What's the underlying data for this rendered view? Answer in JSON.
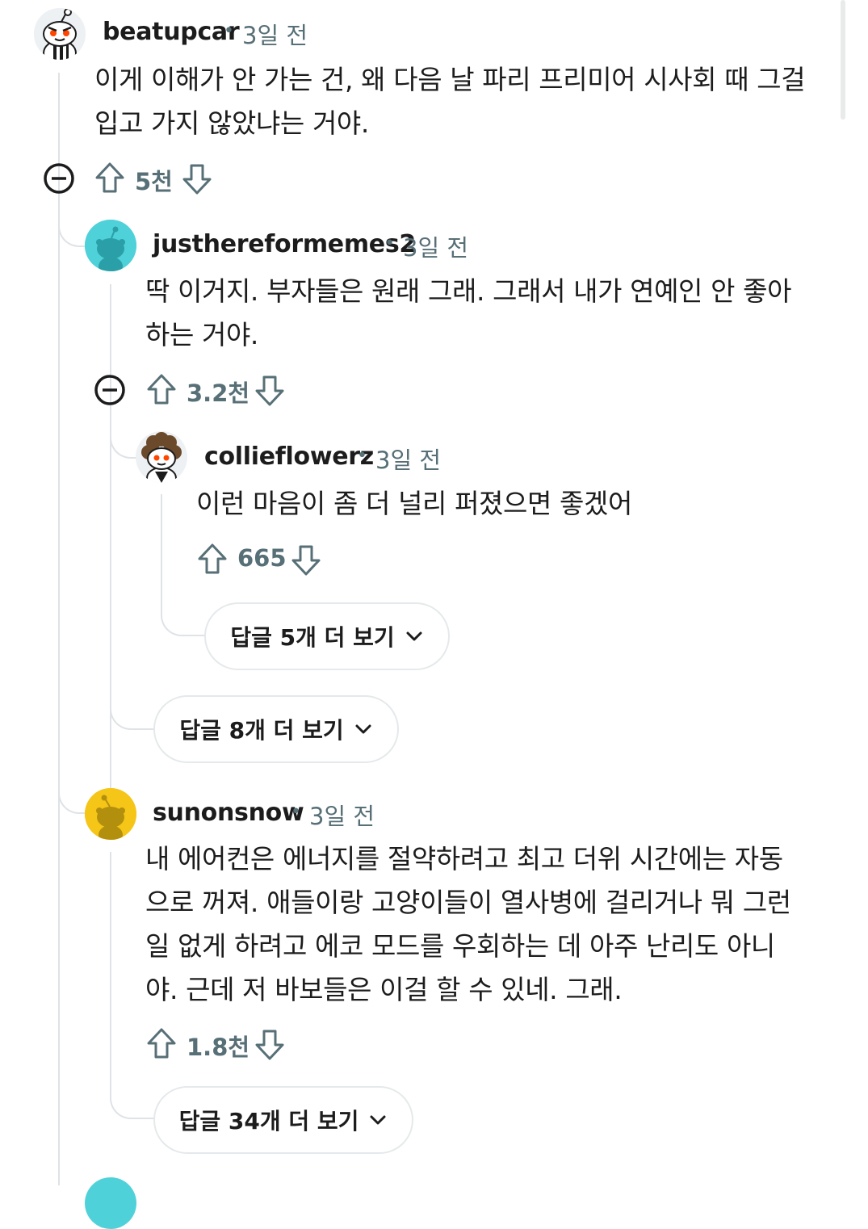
{
  "comments": [
    {
      "username": "beatupcar",
      "time": "3일 전",
      "lines": [
        "이게 이해가 안 가는 건, 왜 다음 날 파리 프리미어 시사회 때 그걸",
        "입고 가지 않았냐는 거야."
      ],
      "score": "5천"
    },
    {
      "username": "justhereformemes2",
      "time": "3일 전",
      "lines": [
        "딱 이거지. 부자들은 원래 그래. 그래서 내가 연예인 안 좋아",
        "하는 거야."
      ],
      "score": "3.2천"
    },
    {
      "username": "collieflowerz",
      "time": "3일 전",
      "lines": [
        "이런 마음이 좀 더 널리 퍼졌으면 좋겠어"
      ],
      "score": "665"
    },
    {
      "username": "sunonsnow",
      "time": "3일 전",
      "lines": [
        "내 에어컨은 에너지를 절약하려고 최고 더위 시간에는 자동",
        "으로 꺼져. 애들이랑 고양이들이 열사병에 걸리거나 뭐 그런",
        "일 없게 하려고 에코 모드를 우회하는 데 아주 난리도 아니",
        "야. 근데 저 바보들은 이걸 할 수 있네. 그래."
      ],
      "score": "1.8천"
    }
  ],
  "more_replies": {
    "collieflowerz": "답글 5개 더 보기",
    "justhereformemes2": "답글 8개 더 보기",
    "sunonsnow": "답글 34개 더 보기"
  },
  "colors": {
    "thread_line": "#dfe3e6",
    "meta_text": "#576f76",
    "avatar_teal": "#4fd1d9",
    "avatar_yellow": "#f5c518"
  }
}
